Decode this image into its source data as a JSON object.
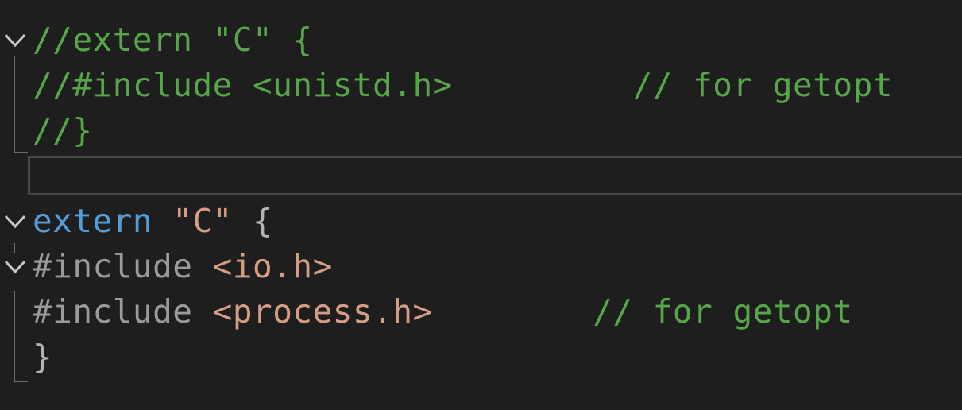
{
  "editor": {
    "lines": [
      {
        "foldable": true,
        "tokens": [
          {
            "text": "//extern \"C\" {",
            "kind": "comment"
          }
        ]
      },
      {
        "foldable": false,
        "tokens": [
          {
            "text": "//#include <unistd.h>",
            "kind": "comment"
          },
          {
            "text": "         ",
            "kind": "space"
          },
          {
            "text": "// for getopt",
            "kind": "comment"
          }
        ]
      },
      {
        "foldable": false,
        "tokens": [
          {
            "text": "//}",
            "kind": "comment"
          }
        ]
      },
      {
        "foldable": false,
        "current": true,
        "tokens": []
      },
      {
        "foldable": true,
        "tokens": [
          {
            "text": "extern",
            "kind": "keyword"
          },
          {
            "text": " ",
            "kind": "space"
          },
          {
            "text": "\"C\"",
            "kind": "string"
          },
          {
            "text": " ",
            "kind": "space"
          },
          {
            "text": "{",
            "kind": "punct"
          }
        ]
      },
      {
        "foldable": true,
        "tokens": [
          {
            "text": "#include",
            "kind": "preproc"
          },
          {
            "text": " ",
            "kind": "space"
          },
          {
            "text": "<io.h>",
            "kind": "string"
          }
        ]
      },
      {
        "foldable": false,
        "tokens": [
          {
            "text": "#include",
            "kind": "preproc"
          },
          {
            "text": " ",
            "kind": "space"
          },
          {
            "text": "<process.h>",
            "kind": "string"
          },
          {
            "text": "        ",
            "kind": "space"
          },
          {
            "text": "// for getopt",
            "kind": "comment"
          }
        ]
      },
      {
        "foldable": false,
        "tokens": [
          {
            "text": "}",
            "kind": "punct"
          }
        ]
      }
    ]
  },
  "colors": {
    "background": "#1e1e1e",
    "comment": "#57a64a",
    "keyword": "#569cd6",
    "string": "#d69d85",
    "punctuation": "#b4b4b4",
    "preprocessor": "#9b9b9b",
    "current_line_border": "#464646",
    "fold_glyph": "#c8c8c8"
  },
  "icons": {
    "fold": "chevron-down-icon"
  }
}
